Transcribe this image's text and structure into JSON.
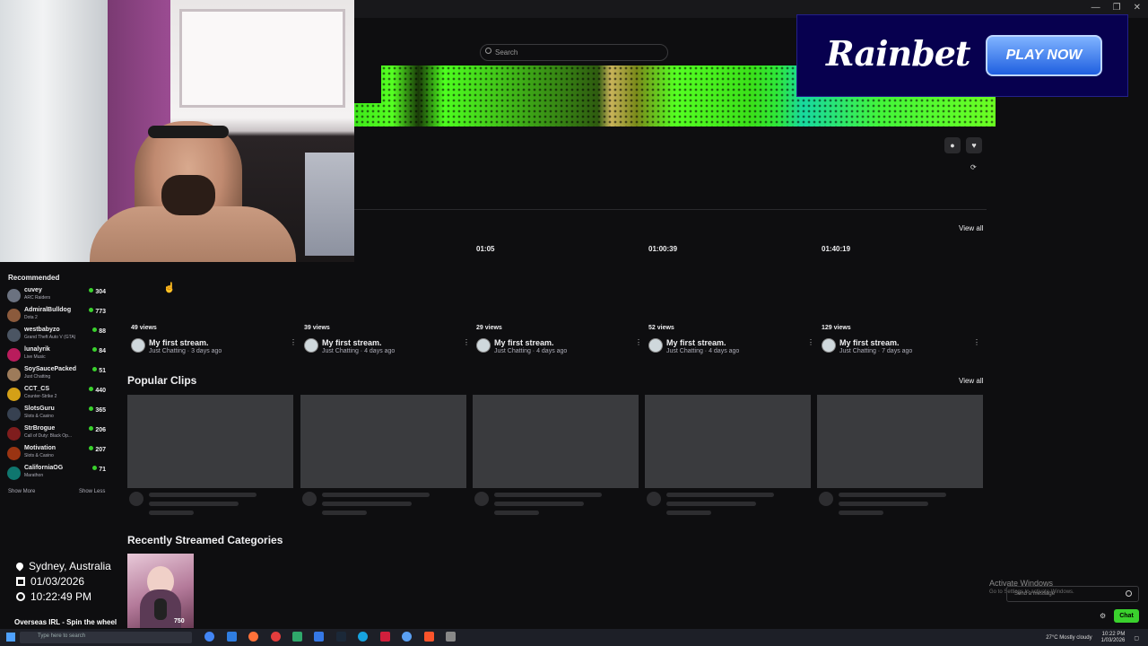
{
  "search": {
    "placeholder": "Search"
  },
  "ad": {
    "brand": "Rainbet",
    "cta": "PLAY NOW"
  },
  "videos": {
    "view_all": "View all",
    "durations": [
      "01:05",
      "01:00:39",
      "01:40:19"
    ],
    "items": [
      {
        "views": "49 views",
        "title": "My first stream.",
        "sub": "Just Chatting · 3 days ago"
      },
      {
        "views": "39 views",
        "title": "My first stream.",
        "sub": "Just Chatting · 4 days ago"
      },
      {
        "views": "29 views",
        "title": "My first stream.",
        "sub": "Just Chatting · 4 days ago"
      },
      {
        "views": "52 views",
        "title": "My first stream.",
        "sub": "Just Chatting · 4 days ago"
      },
      {
        "views": "129 views",
        "title": "My first stream.",
        "sub": "Just Chatting · 7 days ago"
      }
    ]
  },
  "clips": {
    "title": "Popular Clips",
    "view_all": "View all"
  },
  "categories": {
    "title": "Recently Streamed Categories",
    "card_viewers": "750"
  },
  "sidebar": {
    "title": "Recommended",
    "channels": [
      {
        "name": "cuvey",
        "game": "ARC Raiders",
        "viewers": "304",
        "color": "#6b7280"
      },
      {
        "name": "AdmiralBulldog",
        "game": "Dota 2",
        "viewers": "773",
        "color": "#8b5a3c"
      },
      {
        "name": "westbabyzo",
        "game": "Grand Theft Auto V (GTA)",
        "viewers": "88",
        "color": "#4b5563"
      },
      {
        "name": "lunalyrik",
        "game": "Live Music",
        "viewers": "84",
        "color": "#b91c5c"
      },
      {
        "name": "SoySaucePacked",
        "game": "Just Chatting",
        "viewers": "51",
        "color": "#9d7b5a"
      },
      {
        "name": "CCT_CS",
        "game": "Counter-Strike 2",
        "viewers": "440",
        "color": "#d4a017"
      },
      {
        "name": "SlotsGuru",
        "game": "Slots & Casino",
        "viewers": "365",
        "color": "#374151"
      },
      {
        "name": "StrBrogue",
        "game": "Call of Duty: Black Op...",
        "viewers": "206",
        "color": "#7f1d1d"
      },
      {
        "name": "Motivation",
        "game": "Slots & Casino",
        "viewers": "207",
        "color": "#9a3412"
      },
      {
        "name": "CaliforniaOG",
        "game": "Marathon",
        "viewers": "71",
        "color": "#0f766e"
      }
    ],
    "show_more": "Show More",
    "show_less": "Show Less"
  },
  "overlay": {
    "location": "Sydney, Australia",
    "date": "01/03/2026",
    "time": "10:22:49 PM",
    "banner": "Overseas IRL - Spin the wheel"
  },
  "system": {
    "activate_title": "Activate Windows",
    "activate_sub": "Go to Settings to activate Windows.",
    "chat_placeholder": "Send a message",
    "chat_button": "Chat",
    "taskbar_search": "Type here to search",
    "weather": "27°C  Mostly cloudy",
    "clock_time": "10:22 PM",
    "clock_date": "1/03/2026"
  },
  "colors": {
    "accent_green": "#3ad12d",
    "background": "#0e0e10",
    "ad_bg": "#07004f"
  }
}
